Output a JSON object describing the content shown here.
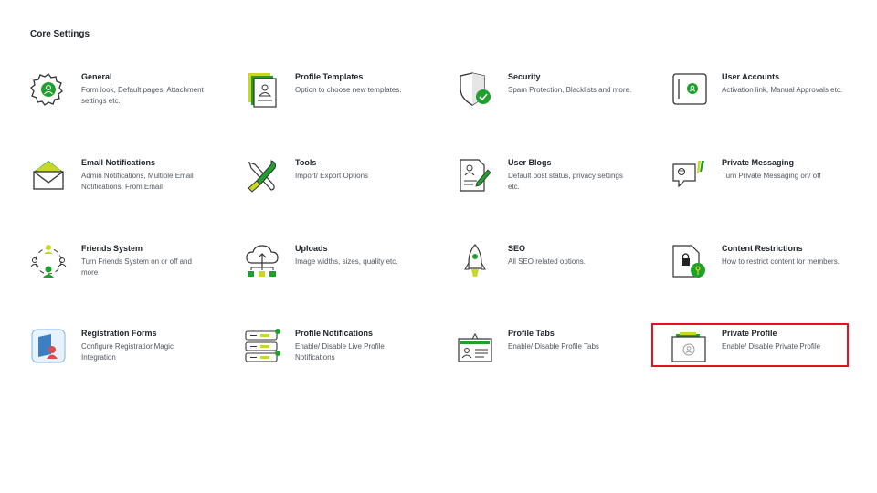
{
  "page": {
    "title": "Core Settings"
  },
  "tiles": [
    {
      "title": "General",
      "desc": "Form look, Default pages, Attachment settings etc.",
      "icon": "gear-icon"
    },
    {
      "title": "Profile Templates",
      "desc": "Option to choose new templates.",
      "icon": "profile-template-icon"
    },
    {
      "title": "Security",
      "desc": "Spam Protection, Blacklists and more.",
      "icon": "shield-icon"
    },
    {
      "title": "User Accounts",
      "desc": "Activation link, Manual Approvals etc.",
      "icon": "user-account-icon"
    },
    {
      "title": "Email Notifications",
      "desc": "Admin Notifications, Multiple Email Notifications, From Email",
      "icon": "envelope-icon"
    },
    {
      "title": "Tools",
      "desc": "Import/ Export Options",
      "icon": "tools-icon"
    },
    {
      "title": "User Blogs",
      "desc": "Default post status, privacy settings etc.",
      "icon": "blog-icon"
    },
    {
      "title": "Private Messaging",
      "desc": "Turn Private Messaging on/ off",
      "icon": "chat-icon"
    },
    {
      "title": "Friends System",
      "desc": "Turn Friends System on or off and more",
      "icon": "friends-icon"
    },
    {
      "title": "Uploads",
      "desc": "Image widths, sizes, quality etc.",
      "icon": "cloud-upload-icon"
    },
    {
      "title": "SEO",
      "desc": "All SEO related options.",
      "icon": "rocket-icon"
    },
    {
      "title": "Content Restrictions",
      "desc": "How to restrict content for members.",
      "icon": "lock-document-icon"
    },
    {
      "title": "Registration Forms",
      "desc": "Configure RegistrationMagic Integration",
      "icon": "registration-magic-icon"
    },
    {
      "title": "Profile Notifications",
      "desc": "Enable/ Disable Live Profile Notifications",
      "icon": "notification-toggles-icon"
    },
    {
      "title": "Profile Tabs",
      "desc": "Enable/ Disable Profile Tabs",
      "icon": "id-card-icon"
    },
    {
      "title": "Private Profile",
      "desc": "Enable/ Disable Private Profile",
      "icon": "private-profile-icon"
    }
  ],
  "colors": {
    "accent": "#1fa02e",
    "lime": "#c8d824",
    "highlight": "#e0141e"
  }
}
